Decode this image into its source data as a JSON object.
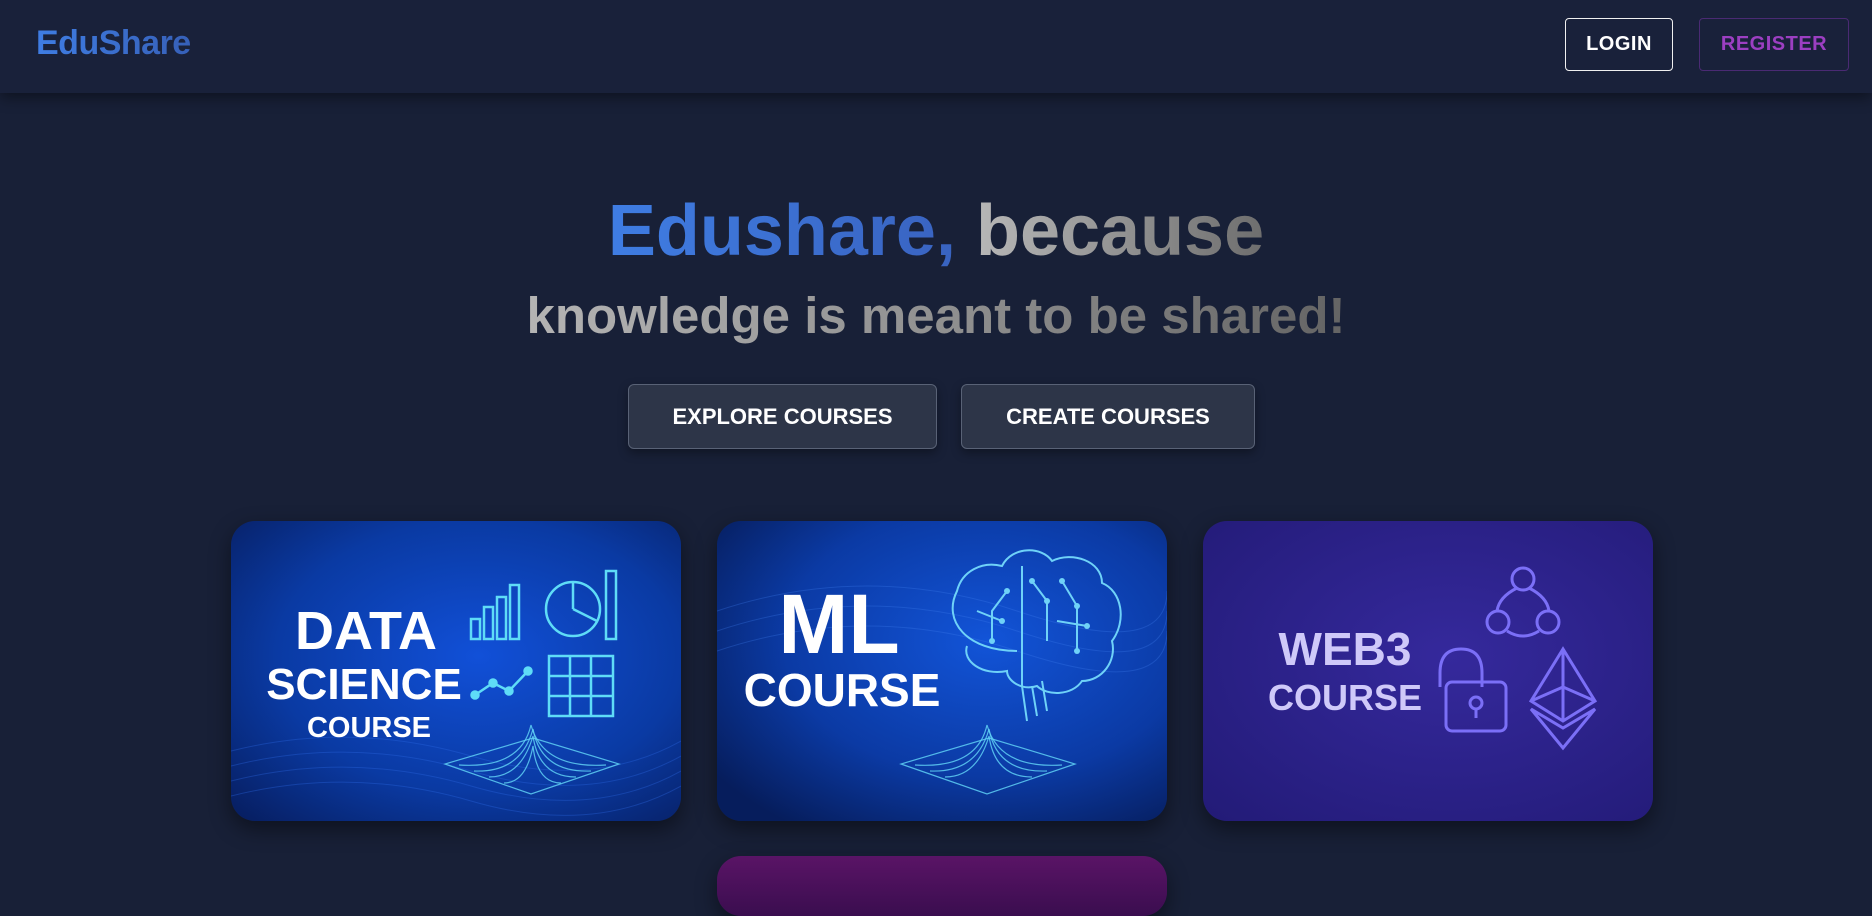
{
  "navbar": {
    "logo": "EduShare",
    "login_label": "LOGIN",
    "register_label": "REGISTER"
  },
  "hero": {
    "brand": "Edushare,",
    "line1_rest": "because",
    "line2": "knowledge is meant to be shared!"
  },
  "actions": {
    "explore_label": "EXPLORE COURSES",
    "create_label": "CREATE COURSES"
  },
  "courses": [
    {
      "line1": "DATA",
      "line2": "SCIENCE",
      "line3": "COURSE",
      "icon": "data-chart-icon"
    },
    {
      "line1": "ML",
      "line2": "COURSE",
      "icon": "brain-icon"
    },
    {
      "line1": "WEB3",
      "line2": "COURSE",
      "icon": "blockchain-icon"
    }
  ],
  "colors": {
    "background": "#182037",
    "brand_blue": "#3f7de3",
    "register_purple": "#9c3fc2",
    "web3_card": "#2c2286",
    "data_card": "#0b3aa8"
  }
}
